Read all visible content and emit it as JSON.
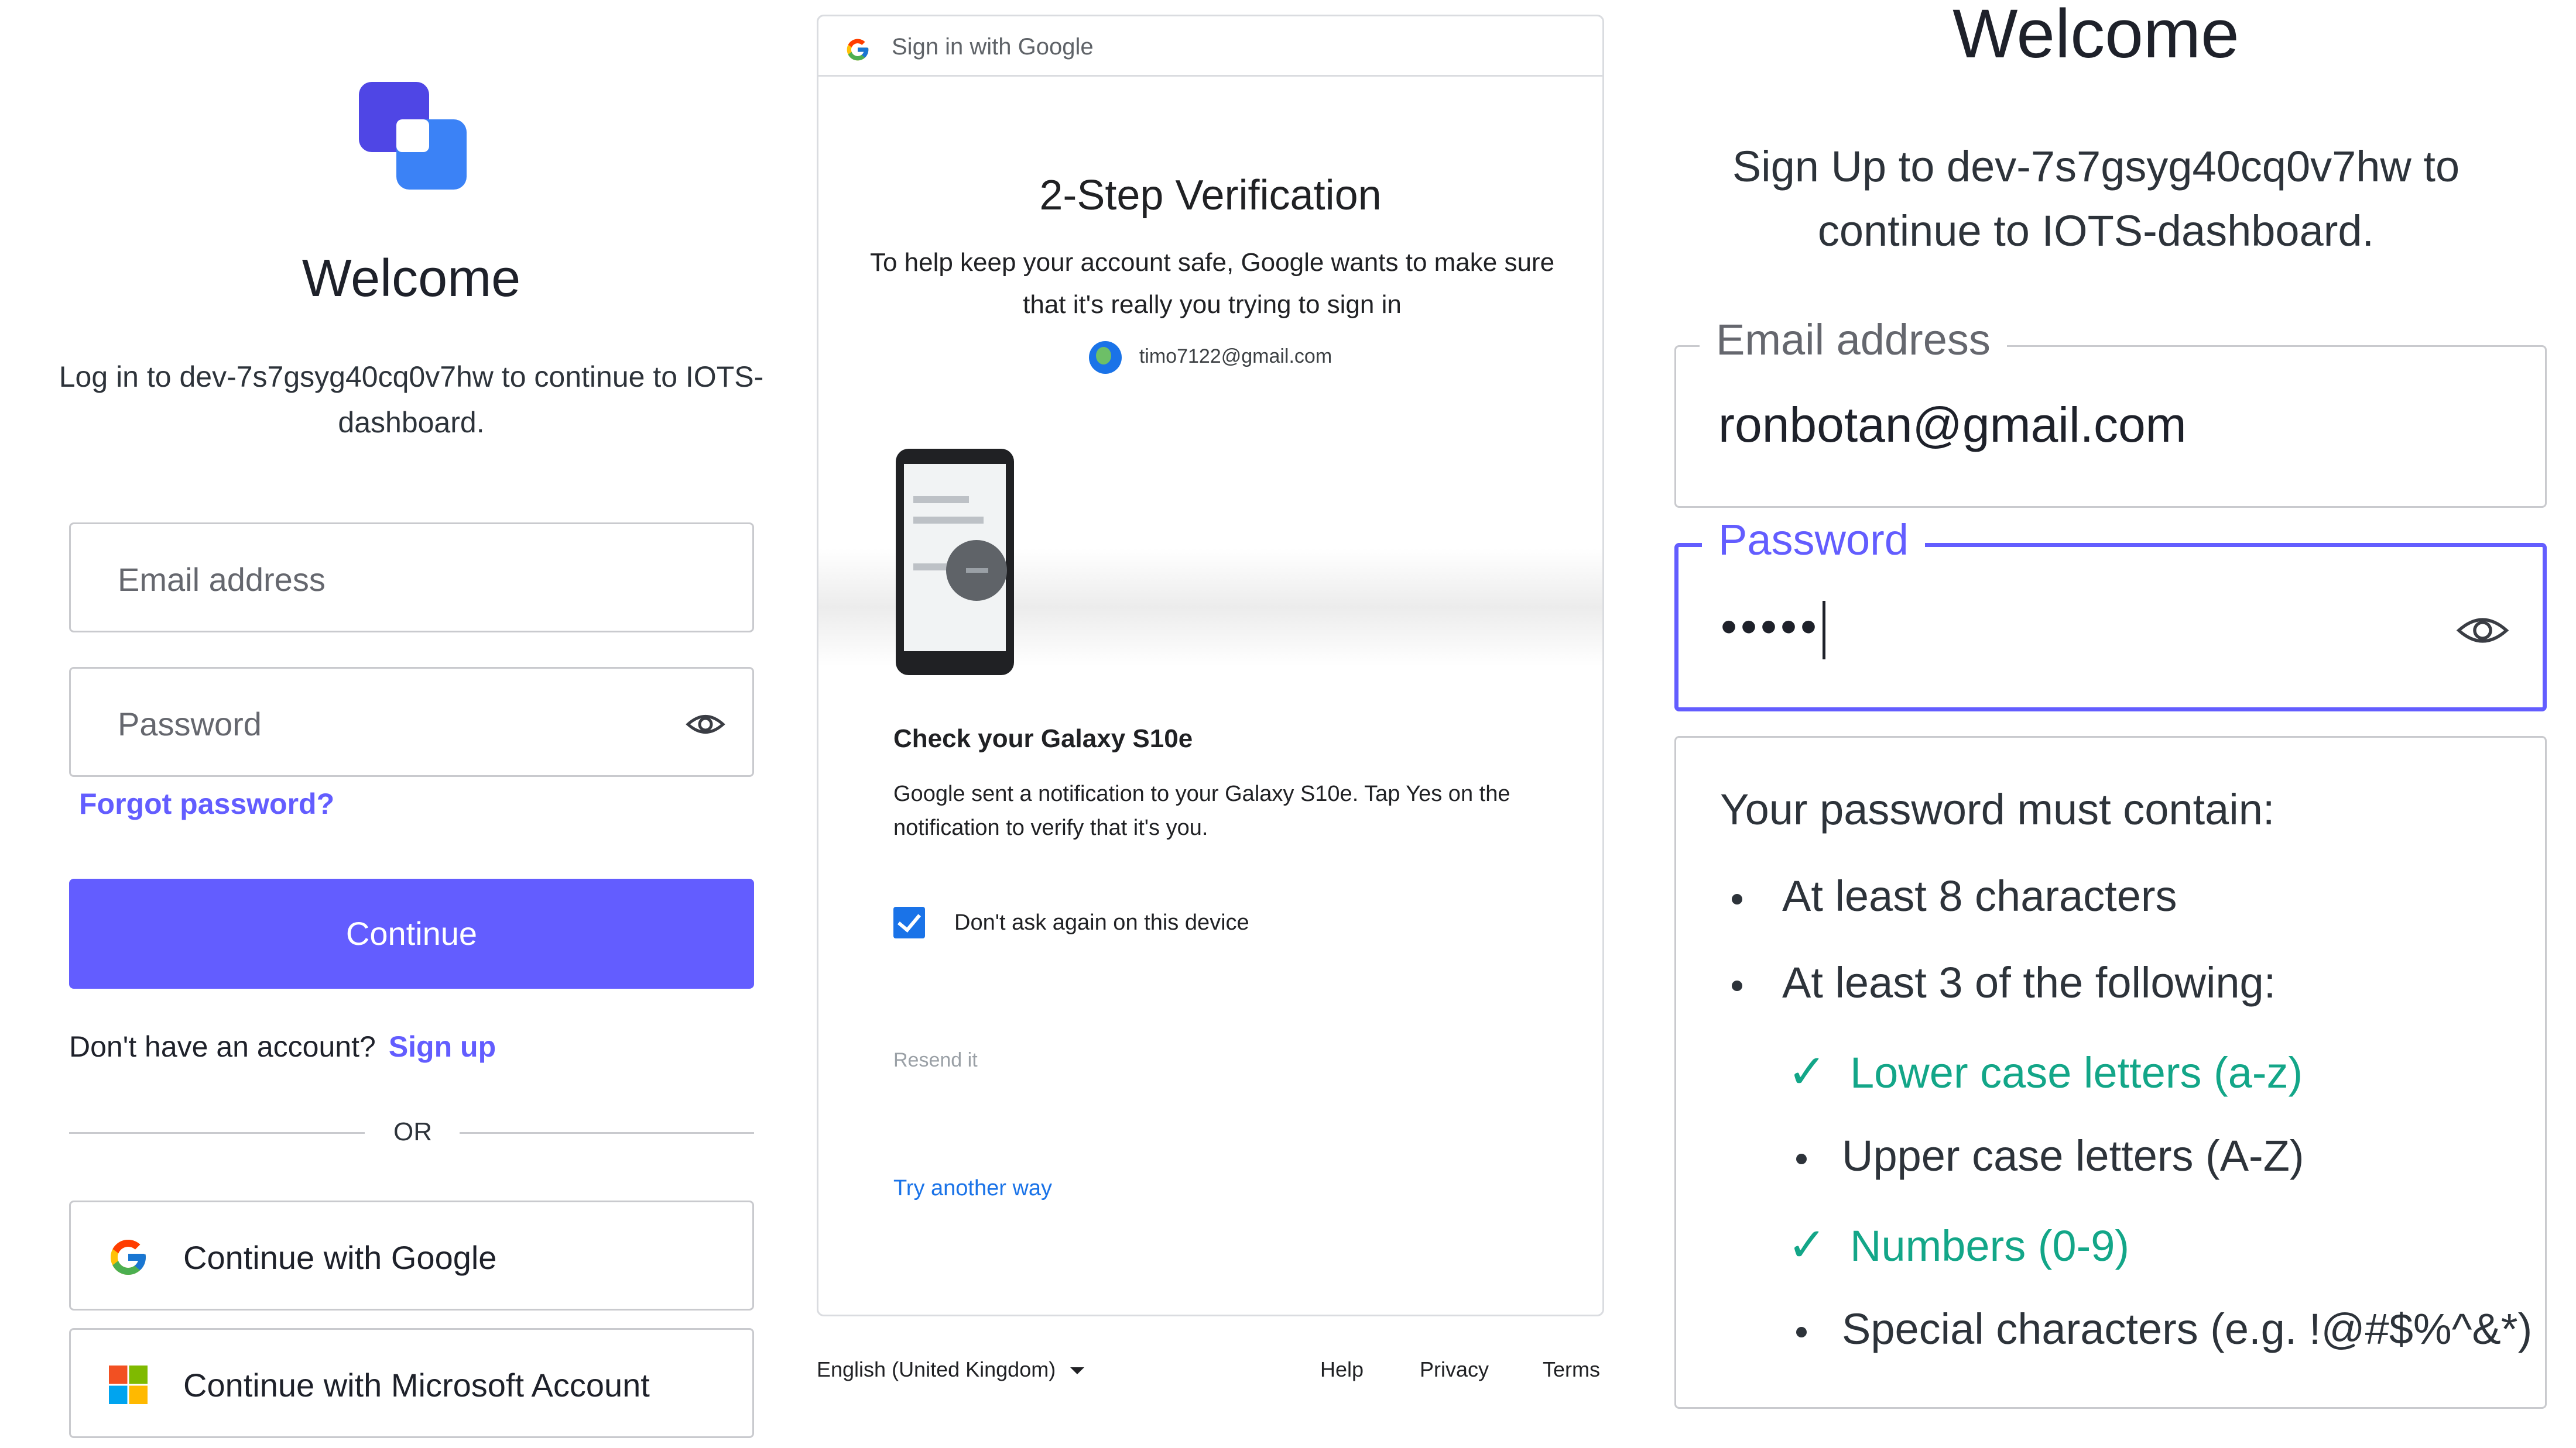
{
  "login": {
    "title": "Welcome",
    "subtitle": "Log in to dev-7s7gsyg40cq0v7hw to continue to IOTS-dashboard.",
    "email_placeholder": "Email address",
    "password_placeholder": "Password",
    "forgot_password": "Forgot password?",
    "continue_label": "Continue",
    "no_account_text": "Don't have an account?",
    "signup_link": "Sign up",
    "or_divider": "OR",
    "google_button": "Continue with Google",
    "microsoft_button": "Continue with Microsoft Account",
    "accent_color": "#635dff"
  },
  "google_verification": {
    "header": "Sign in with Google",
    "title": "2-Step Verification",
    "subtitle": "To help keep your account safe, Google wants to make sure that it's really you trying to sign in",
    "account_email": "timo7122@gmail.com",
    "device_title": "Check your Galaxy S10e",
    "device_description": "Google sent a notification to your Galaxy S10e. Tap Yes on the notification to verify that it's you.",
    "dont_ask_again_label": "Don't ask again on this device",
    "dont_ask_again_checked": true,
    "resend_label": "Resend it",
    "try_another_way": "Try another way",
    "footer": {
      "language": "English (United Kingdom)",
      "help": "Help",
      "privacy": "Privacy",
      "terms": "Terms"
    }
  },
  "signup": {
    "title": "Welcome",
    "subtitle": "Sign Up to dev-7s7gsyg40cq0v7hw to continue to IOTS-dashboard.",
    "email_label": "Email address",
    "email_value": "ronbotan@gmail.com",
    "password_label": "Password",
    "password_value": "•••••",
    "rules_title": "Your password must contain:",
    "rules": [
      {
        "text": "At least 8 characters",
        "status": "pending"
      },
      {
        "text": "At least 3 of the following:",
        "status": "pending"
      },
      {
        "text": "Lower case letters (a-z)",
        "status": "met"
      },
      {
        "text": "Upper case letters (A-Z)",
        "status": "pending"
      },
      {
        "text": "Numbers (0-9)",
        "status": "met"
      },
      {
        "text": "Special characters (e.g. !@#$%^&*)",
        "status": "pending"
      }
    ],
    "met_color": "#13a688"
  }
}
